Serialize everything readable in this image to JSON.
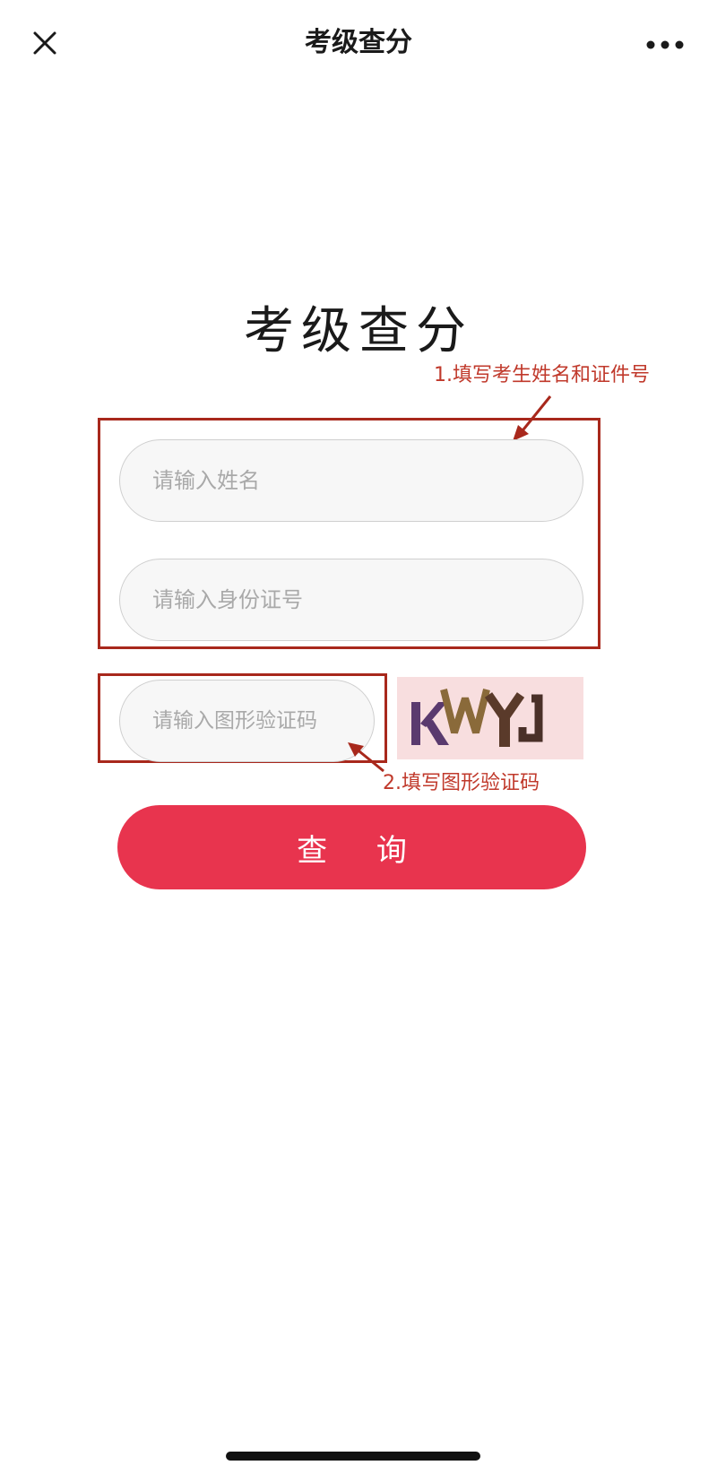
{
  "nav": {
    "title": "考级查分",
    "close_icon": "close-icon",
    "more_icon": "more-dots-icon"
  },
  "form": {
    "title": "考级查分",
    "name_placeholder": "请输入姓名",
    "id_placeholder": "请输入身份证号",
    "captcha_placeholder": "请输入图形验证码",
    "captcha_text": "KWYJ",
    "submit_label": "查 询"
  },
  "annotations": {
    "step1": "1.填写考生姓名和证件号",
    "step2": "2.填写图形验证码",
    "color": "#a8281c"
  },
  "colors": {
    "accent": "#e8344e",
    "captcha_bg": "#f8dedf"
  }
}
